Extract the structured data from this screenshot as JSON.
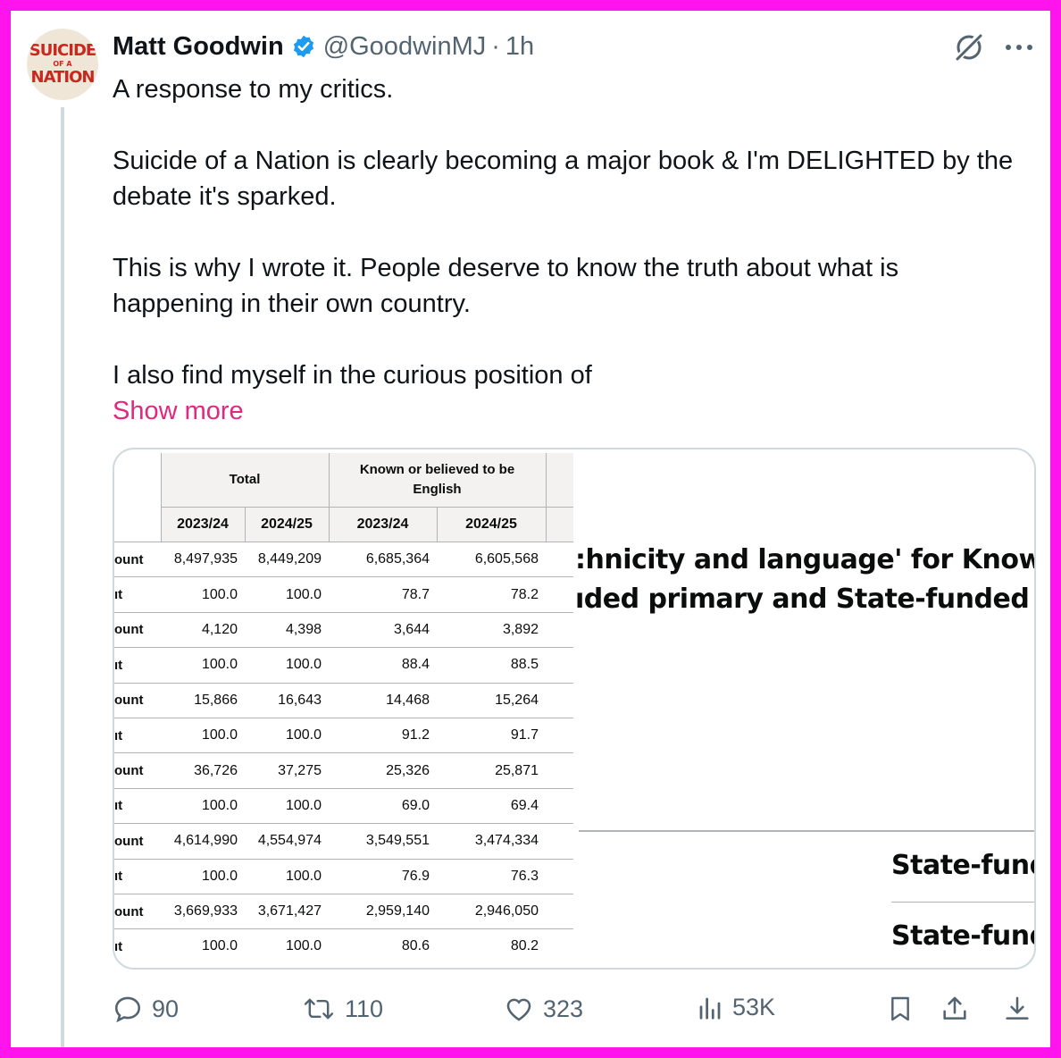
{
  "tweet": {
    "author_name": "Matt Goodwin",
    "handle": "@GoodwinMJ",
    "separator": "·",
    "time": "1h",
    "avatar_text": [
      "SUICIDE",
      "OF A",
      "NATION"
    ],
    "paragraphs": [
      "A response to my critics.",
      "Suicide of a Nation is clearly becoming a major book & I'm DELIGHTED by the debate it's sparked.",
      "This is why I wrote it. People deserve to know the truth about what is happening in their own country.",
      "I also find myself in the curious position of"
    ],
    "show_more": "Show more"
  },
  "media": {
    "table": {
      "group_headers": [
        "Total",
        "Known or believed to be English"
      ],
      "year_headers": [
        "2023/24",
        "2024/25",
        "2023/24",
        "2024/25"
      ],
      "rows": [
        {
          "label": "ount",
          "values": [
            "8,497,935",
            "8,449,209",
            "6,685,364",
            "6,605,568"
          ]
        },
        {
          "label": "ıt",
          "values": [
            "100.0",
            "100.0",
            "78.7",
            "78.2"
          ]
        },
        {
          "label": "ount",
          "values": [
            "4,120",
            "4,398",
            "3,644",
            "3,892"
          ]
        },
        {
          "label": "ıt",
          "values": [
            "100.0",
            "100.0",
            "88.4",
            "88.5"
          ]
        },
        {
          "label": "ount",
          "values": [
            "15,866",
            "16,643",
            "14,468",
            "15,264"
          ]
        },
        {
          "label": "ıt",
          "values": [
            "100.0",
            "100.0",
            "91.2",
            "91.7"
          ]
        },
        {
          "label": "ount",
          "values": [
            "36,726",
            "37,275",
            "25,326",
            "25,871"
          ]
        },
        {
          "label": "ıt",
          "values": [
            "100.0",
            "100.0",
            "69.0",
            "69.4"
          ]
        },
        {
          "label": "ount",
          "values": [
            "4,614,990",
            "4,554,974",
            "3,549,551",
            "3,474,334"
          ]
        },
        {
          "label": "ıt",
          "values": [
            "100.0",
            "100.0",
            "76.9",
            "76.3"
          ]
        },
        {
          "label": "ount",
          "values": [
            "3,669,933",
            "3,671,427",
            "2,959,140",
            "2,946,050"
          ]
        },
        {
          "label": "ıt",
          "values": [
            "100.0",
            "100.0",
            "80.6",
            "80.2"
          ]
        }
      ]
    },
    "right_title_line1": ":hnicity and language' for Known or",
    "right_title_line2": "ıded primary and State-funded seco",
    "state_funded_1": "State-fund",
    "state_funded_2": "State-fund"
  },
  "actions": {
    "replies": "90",
    "reposts": "110",
    "likes": "323",
    "views": "53K"
  },
  "colors": {
    "frame": "#ff14ee",
    "link": "#e0287e",
    "verified": "#1d9bf0",
    "secondary_text": "#536471"
  }
}
